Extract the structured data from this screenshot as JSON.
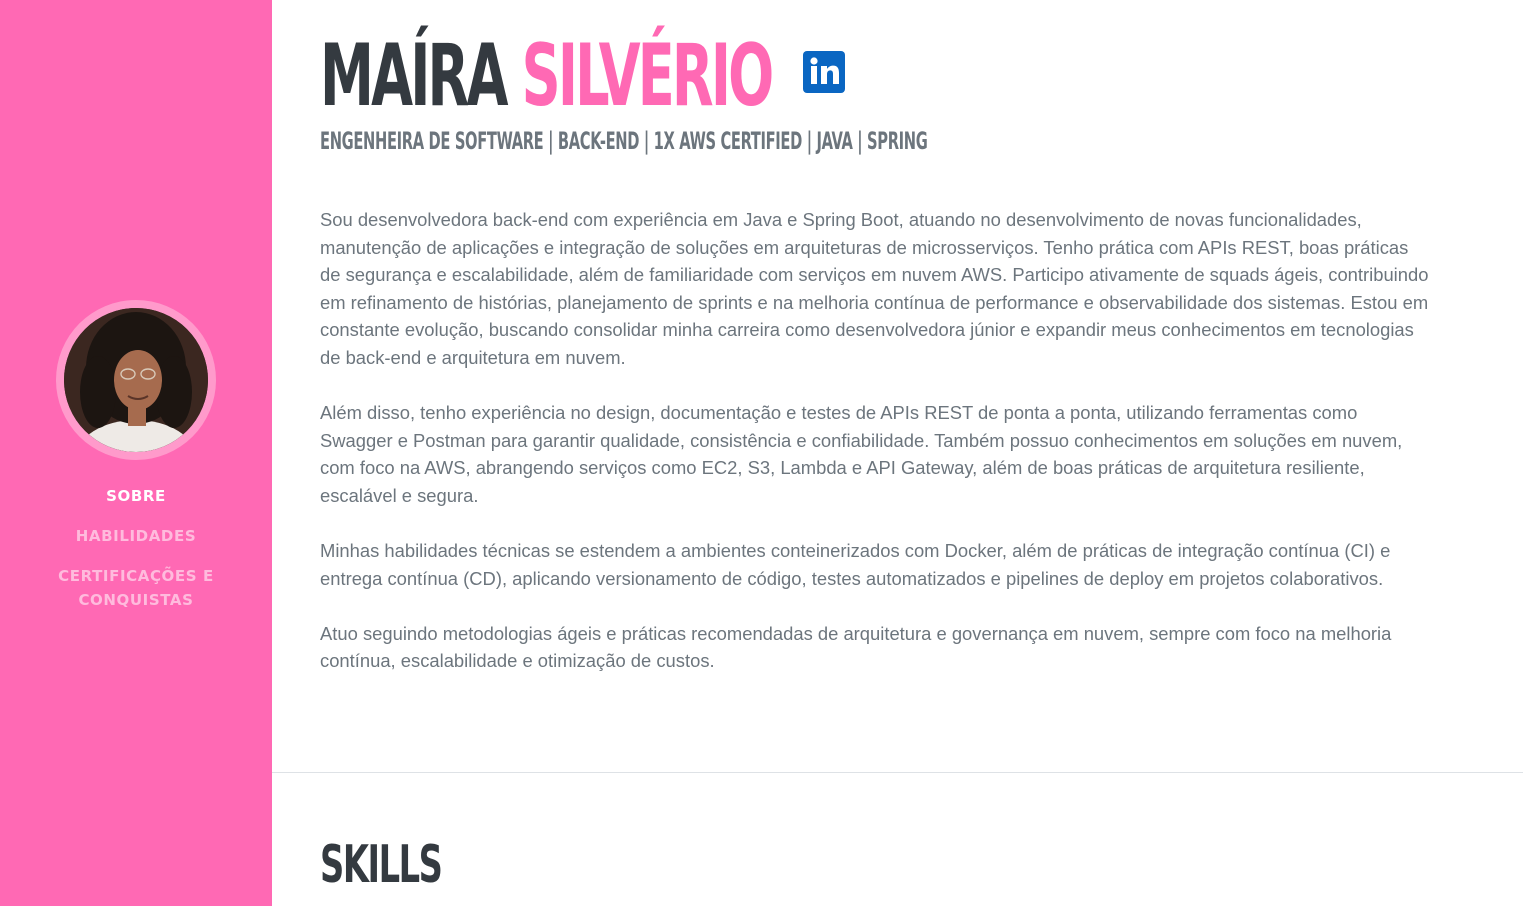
{
  "sidebar": {
    "avatar_alt": "Maíra Silvério",
    "nav": [
      {
        "label": "Sobre",
        "active": true
      },
      {
        "label": "Habilidades",
        "active": false
      },
      {
        "label": "Certificações e Conquistas",
        "active": false
      }
    ]
  },
  "header": {
    "first_name": "MAÍRA",
    "last_name": "SILVÉRIO",
    "linkedin_icon": "linkedin-icon",
    "subtitle": "ENGENHEIRA DE SOFTWARE | BACK-END | 1X AWS CERTIFIED | JAVA | SPRING"
  },
  "about": {
    "paragraphs": [
      "Sou desenvolvedora back-end com experiência em Java e Spring Boot, atuando no desenvolvimento de novas funcionalidades, manutenção de aplicações e integração de soluções em arquiteturas de microsserviços. Tenho prática com APIs REST, boas práticas de segurança e escalabilidade, além de familiaridade com serviços em nuvem AWS. Participo ativamente de squads ágeis, contribuindo em refinamento de histórias, planejamento de sprints e na melhoria contínua de performance e observabilidade dos sistemas. Estou em constante evolução, buscando consolidar minha carreira como desenvolvedora júnior e expandir meus conhecimentos em tecnologias de back-end e arquitetura em nuvem.",
      "Além disso, tenho experiência no design, documentação e testes de APIs REST de ponta a ponta, utilizando ferramentas como Swagger e Postman para garantir qualidade, consistência e confiabilidade. Também possuo conhecimentos em soluções em nuvem, com foco na AWS, abrangendo serviços como EC2, S3, Lambda e API Gateway, além de boas práticas de arquitetura resiliente, escalável e segura.",
      "Minhas habilidades técnicas se estendem a ambientes conteinerizados com Docker, além de práticas de integração contínua (CI) e entrega contínua (CD), aplicando versionamento de código, testes automatizados e pipelines de deploy em projetos colaborativos.",
      "Atuo seguindo metodologias ágeis e práticas recomendadas de arquitetura e governança em nuvem, sempre com foco na melhoria contínua, escalabilidade e otimização de custos."
    ]
  },
  "skills": {
    "title": "SKILLS"
  },
  "colors": {
    "accent": "#ff69b4",
    "heading": "#343a40",
    "body_text": "#6c757d",
    "linkedin": "#0a66c2"
  }
}
